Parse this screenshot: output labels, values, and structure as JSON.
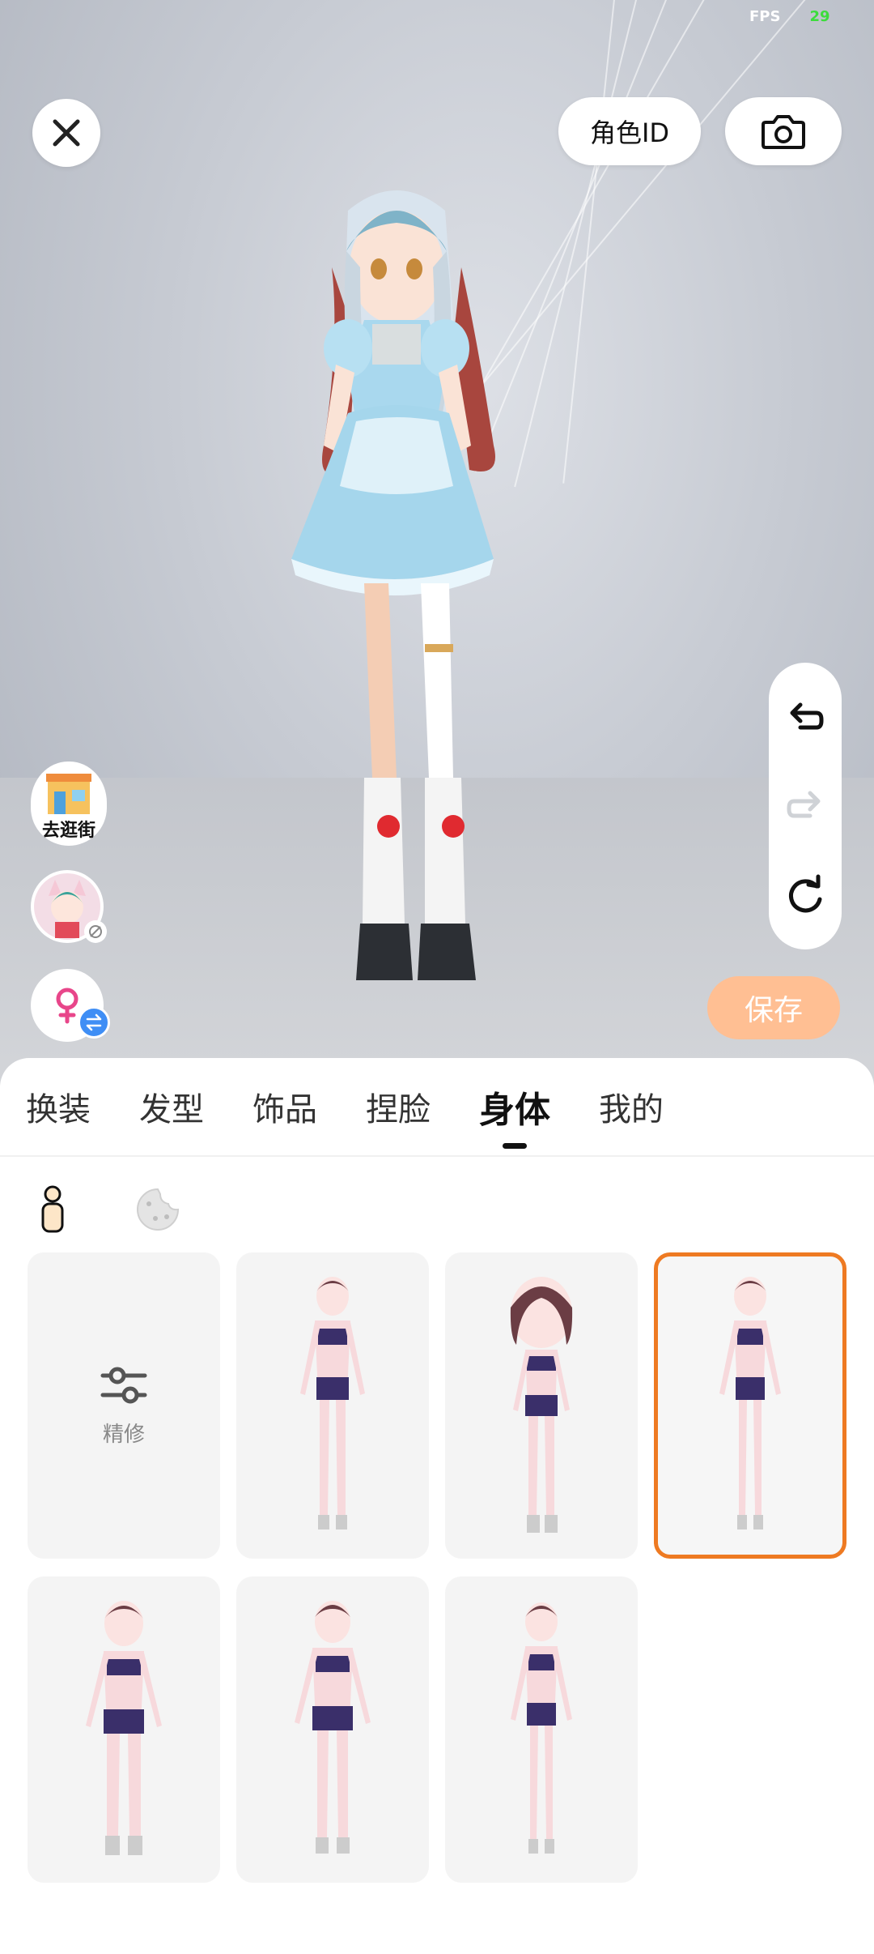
{
  "fps": {
    "label": "FPS",
    "value": "29"
  },
  "header": {
    "role_id_label": "角色ID"
  },
  "scene": {
    "shop_label": "去逛街"
  },
  "actions": {
    "save_label": "保存"
  },
  "panel": {
    "tabs": [
      {
        "label": "换装",
        "active": false
      },
      {
        "label": "发型",
        "active": false
      },
      {
        "label": "饰品",
        "active": false
      },
      {
        "label": "捏脸",
        "active": false
      },
      {
        "label": "身体",
        "active": true
      },
      {
        "label": "我的",
        "active": false
      }
    ],
    "subtabs": [
      {
        "icon": "body-figure-icon",
        "active": true
      },
      {
        "icon": "skin-palette-icon",
        "active": false
      }
    ],
    "refine_label": "精修",
    "body_presets_count": 6,
    "selected_preset": 3
  },
  "colors": {
    "accent_orange": "#ee7a22",
    "save_button": "#ffbf93",
    "fps_value": "#3cdc3c",
    "badge_blue": "#3f8ef5",
    "female_pink": "#e8468a"
  }
}
